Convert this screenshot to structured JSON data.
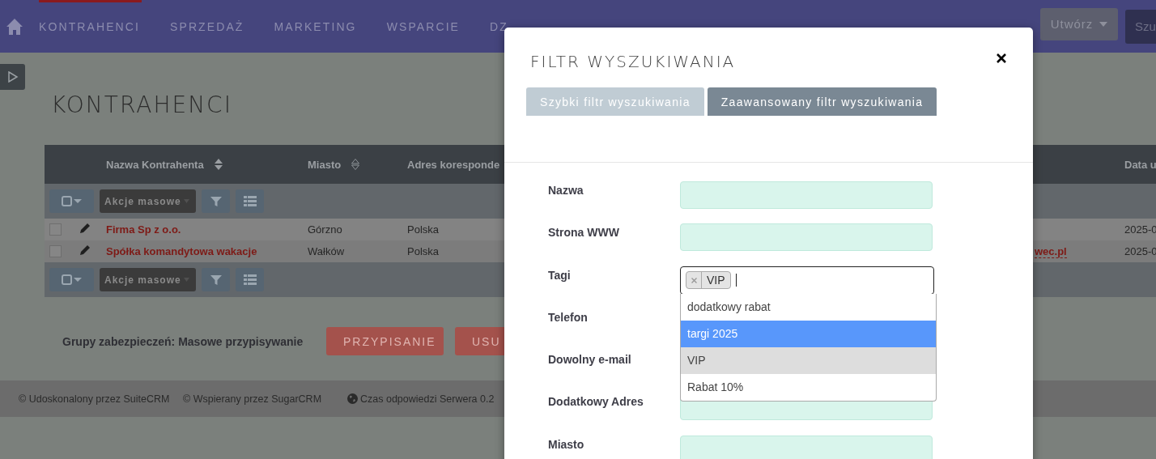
{
  "nav": {
    "items": [
      {
        "label": "KONTRAHENCI"
      },
      {
        "label": "SPRZEDAŻ"
      },
      {
        "label": "MARKETING"
      },
      {
        "label": "WSPARCIE"
      },
      {
        "label": "DZ"
      }
    ],
    "create_button": "Utwórz",
    "search_button": "Szu"
  },
  "page_title": "KONTRAHENCI",
  "table": {
    "columns": [
      {
        "kind": "label",
        "label": "Nazwa Kontrahenta",
        "sorted": true
      },
      {
        "kind": "label",
        "label": "Miasto",
        "sorted": false
      },
      {
        "kind": "label",
        "label": "Adres koresponde"
      },
      {
        "kind": "covered"
      },
      {
        "kind": "label",
        "label": "Data u"
      }
    ],
    "toolbars": [
      {
        "mass_actions": "Akcje masowe"
      },
      {
        "mass_actions": "Akcje masowe"
      }
    ],
    "rows": [
      {
        "checked": false,
        "name": "Firma Sp z o.o.",
        "city": "Górzno",
        "address": "Polska",
        "date": "2025-0"
      },
      {
        "checked": false,
        "name": "Spółka komandytowa wakacje",
        "city": "Wałków",
        "address": "Polska",
        "email": "wec.pl",
        "date": "2025-0"
      }
    ]
  },
  "security": {
    "label": "Grupy zabezpieczeń: Masowe przypisywanie",
    "buttons": [
      "PRZYPISANIE",
      "USU"
    ]
  },
  "footer": {
    "items": [
      {
        "kind": "text",
        "text": "© Udoskonalony przez SuiteCRM"
      },
      {
        "kind": "text",
        "text": "© Wspierany przez SugarCRM"
      },
      {
        "kind": "globe",
        "text": "Czas odpowiedzi Serwera 0.2"
      }
    ]
  },
  "modal": {
    "title": "FILTR WYSZUKIWANIA",
    "tabs": [
      {
        "label": "Szybki filtr wyszukiwania",
        "selected": false
      },
      {
        "label": "Zaawansowany filtr wyszukiwania",
        "selected": true
      }
    ],
    "fields": [
      {
        "label": "Nazwa",
        "kind": "text"
      },
      {
        "label": "Strona WWW",
        "kind": "text"
      },
      {
        "label": "Tagi",
        "kind": "tags",
        "tags": [
          "VIP"
        ]
      },
      {
        "label": "Telefon",
        "kind": "covered"
      },
      {
        "label": "Dowolny e-mail",
        "kind": "covered"
      },
      {
        "label": "Dodatkowy Adres",
        "kind": "text"
      },
      {
        "label": "Miasto",
        "kind": "text"
      }
    ],
    "dropdown": {
      "options": [
        {
          "label": "dodatkowy rabat",
          "selected": false,
          "highlighted": false
        },
        {
          "label": "targi 2025",
          "selected": false,
          "highlighted": true
        },
        {
          "label": "VIP",
          "selected": true,
          "highlighted": false
        },
        {
          "label": "Rabat 10%",
          "selected": false,
          "highlighted": false
        }
      ]
    }
  }
}
